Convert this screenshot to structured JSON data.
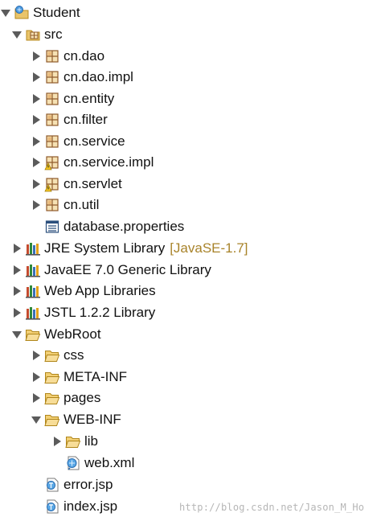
{
  "tree": {
    "project": "Student",
    "src": "src",
    "packages": [
      "cn.dao",
      "cn.dao.impl",
      "cn.entity",
      "cn.filter",
      "cn.service",
      "cn.service.impl",
      "cn.servlet",
      "cn.util"
    ],
    "properties_file": "database.properties",
    "libraries": [
      {
        "label": "JRE System Library",
        "decoration": "[JavaSE-1.7]"
      },
      {
        "label": "JavaEE 7.0 Generic Library"
      },
      {
        "label": "Web App Libraries"
      },
      {
        "label": "JSTL 1.2.2 Library"
      }
    ],
    "webroot": "WebRoot",
    "webroot_folders": [
      "css",
      "META-INF",
      "pages",
      "WEB-INF"
    ],
    "webinf_children": [
      "lib",
      "web.xml"
    ],
    "jsp_files": [
      "error.jsp",
      "index.jsp"
    ]
  },
  "watermark": "http://blog.csdn.net/Jason_M_Ho"
}
